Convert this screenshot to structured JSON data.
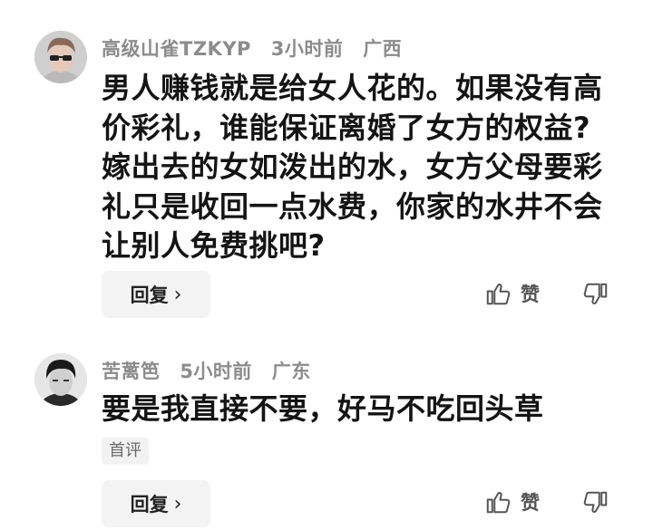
{
  "comments": [
    {
      "username": "高级山雀TZKYP",
      "time": "3小时前",
      "location": "广西",
      "lines": [
        "男人赚钱就是给女人花的。如果没有高",
        "价彩礼，谁能保证离婚了女方的权益?",
        "嫁出去的女如泼出的水，女方父母要彩",
        "礼只是收回一点水费，你家的水井不会",
        "让别人免费挑吧?"
      ],
      "reply_label": "回复",
      "like_label": "赞"
    },
    {
      "username": "苦蓠笆",
      "time": "5小时前",
      "location": "广东",
      "lines": [
        "要是我直接不要，好马不吃回头草"
      ],
      "tag": "首评",
      "reply_label": "回复",
      "like_label": "赞"
    }
  ],
  "icons": {
    "reply_chevron": "chevron-right-icon",
    "like": "thumb-up-icon",
    "dislike": "thumb-down-icon"
  },
  "colors": {
    "meta_text": "#8c8c8c",
    "body_text": "#141414",
    "reply_bg": "#f3f3f3"
  }
}
